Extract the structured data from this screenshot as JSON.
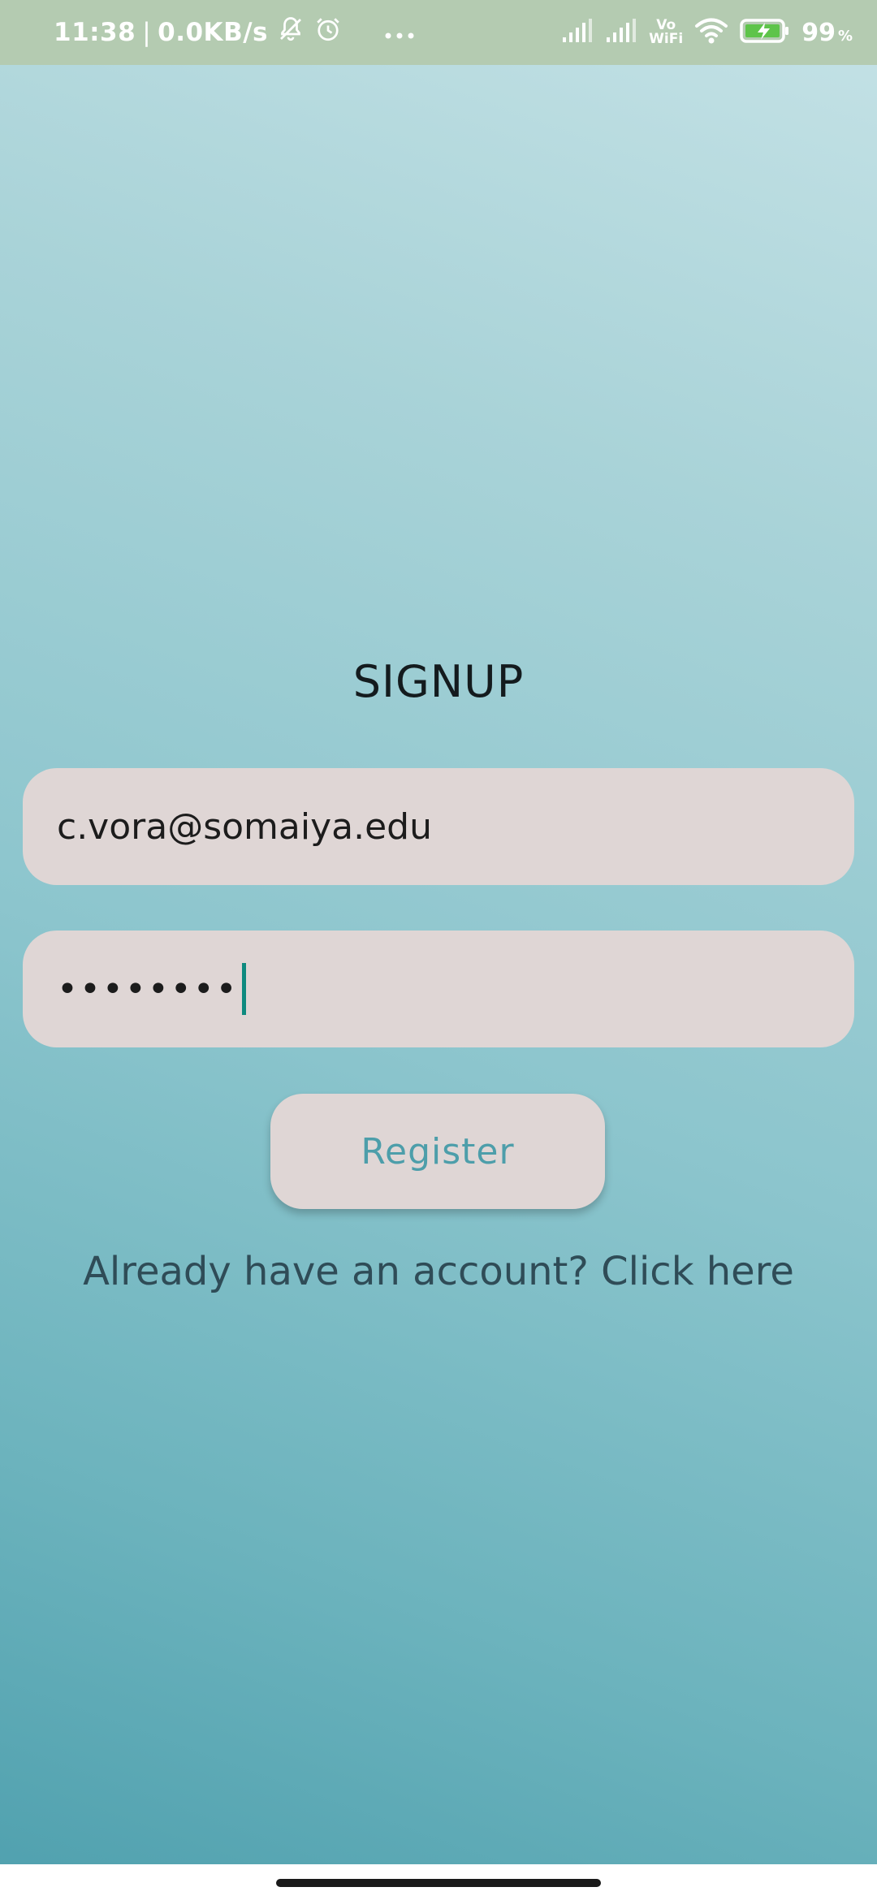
{
  "status_bar": {
    "time": "11:38",
    "separator": "|",
    "network_speed": "0.0KB/s",
    "vowifi_top": "Vo",
    "vowifi_bottom": "WiFi",
    "battery_percent": "99",
    "battery_unit": "%",
    "icons": [
      "notifications-muted-icon",
      "alarm-icon",
      "more-dots-icon",
      "signal-icon",
      "signal-icon",
      "wifi-icon",
      "battery-charging-icon"
    ]
  },
  "form": {
    "title": "SIGNUP",
    "email_value": "c.vora@somaiya.edu",
    "password_value": "••••••••",
    "register_label": "Register",
    "login_link": "Already have an account? Click here"
  },
  "colors": {
    "status_bar": "#b4cbb1",
    "field_background": "#dfd6d5",
    "button_text": "#4d9eaa",
    "cursor": "#0e8a7f"
  }
}
